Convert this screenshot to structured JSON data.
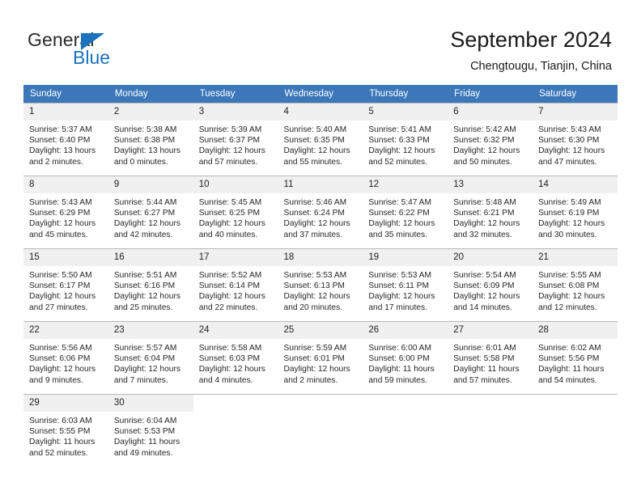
{
  "logo": {
    "word_top": "General",
    "word_bottom": "Blue",
    "triangle_color": "#1b72bd",
    "text_color": "#2b2b2b"
  },
  "header": {
    "title": "September 2024",
    "subtitle": "Chengtougu, Tianjin, China"
  },
  "theme": {
    "header_row_bg": "#3b77b9",
    "daynum_bg": "#f0f0f0",
    "grid_line": "#b9b9b9",
    "page_bg": "#ffffff"
  },
  "weekday_headers": [
    "Sunday",
    "Monday",
    "Tuesday",
    "Wednesday",
    "Thursday",
    "Friday",
    "Saturday"
  ],
  "weeks": [
    [
      {
        "day": "1",
        "sunrise": "Sunrise: 5:37 AM",
        "sunset": "Sunset: 6:40 PM",
        "daylight_line1": "Daylight: 13 hours",
        "daylight_line2": "and 2 minutes."
      },
      {
        "day": "2",
        "sunrise": "Sunrise: 5:38 AM",
        "sunset": "Sunset: 6:38 PM",
        "daylight_line1": "Daylight: 13 hours",
        "daylight_line2": "and 0 minutes."
      },
      {
        "day": "3",
        "sunrise": "Sunrise: 5:39 AM",
        "sunset": "Sunset: 6:37 PM",
        "daylight_line1": "Daylight: 12 hours",
        "daylight_line2": "and 57 minutes."
      },
      {
        "day": "4",
        "sunrise": "Sunrise: 5:40 AM",
        "sunset": "Sunset: 6:35 PM",
        "daylight_line1": "Daylight: 12 hours",
        "daylight_line2": "and 55 minutes."
      },
      {
        "day": "5",
        "sunrise": "Sunrise: 5:41 AM",
        "sunset": "Sunset: 6:33 PM",
        "daylight_line1": "Daylight: 12 hours",
        "daylight_line2": "and 52 minutes."
      },
      {
        "day": "6",
        "sunrise": "Sunrise: 5:42 AM",
        "sunset": "Sunset: 6:32 PM",
        "daylight_line1": "Daylight: 12 hours",
        "daylight_line2": "and 50 minutes."
      },
      {
        "day": "7",
        "sunrise": "Sunrise: 5:43 AM",
        "sunset": "Sunset: 6:30 PM",
        "daylight_line1": "Daylight: 12 hours",
        "daylight_line2": "and 47 minutes."
      }
    ],
    [
      {
        "day": "8",
        "sunrise": "Sunrise: 5:43 AM",
        "sunset": "Sunset: 6:29 PM",
        "daylight_line1": "Daylight: 12 hours",
        "daylight_line2": "and 45 minutes."
      },
      {
        "day": "9",
        "sunrise": "Sunrise: 5:44 AM",
        "sunset": "Sunset: 6:27 PM",
        "daylight_line1": "Daylight: 12 hours",
        "daylight_line2": "and 42 minutes."
      },
      {
        "day": "10",
        "sunrise": "Sunrise: 5:45 AM",
        "sunset": "Sunset: 6:25 PM",
        "daylight_line1": "Daylight: 12 hours",
        "daylight_line2": "and 40 minutes."
      },
      {
        "day": "11",
        "sunrise": "Sunrise: 5:46 AM",
        "sunset": "Sunset: 6:24 PM",
        "daylight_line1": "Daylight: 12 hours",
        "daylight_line2": "and 37 minutes."
      },
      {
        "day": "12",
        "sunrise": "Sunrise: 5:47 AM",
        "sunset": "Sunset: 6:22 PM",
        "daylight_line1": "Daylight: 12 hours",
        "daylight_line2": "and 35 minutes."
      },
      {
        "day": "13",
        "sunrise": "Sunrise: 5:48 AM",
        "sunset": "Sunset: 6:21 PM",
        "daylight_line1": "Daylight: 12 hours",
        "daylight_line2": "and 32 minutes."
      },
      {
        "day": "14",
        "sunrise": "Sunrise: 5:49 AM",
        "sunset": "Sunset: 6:19 PM",
        "daylight_line1": "Daylight: 12 hours",
        "daylight_line2": "and 30 minutes."
      }
    ],
    [
      {
        "day": "15",
        "sunrise": "Sunrise: 5:50 AM",
        "sunset": "Sunset: 6:17 PM",
        "daylight_line1": "Daylight: 12 hours",
        "daylight_line2": "and 27 minutes."
      },
      {
        "day": "16",
        "sunrise": "Sunrise: 5:51 AM",
        "sunset": "Sunset: 6:16 PM",
        "daylight_line1": "Daylight: 12 hours",
        "daylight_line2": "and 25 minutes."
      },
      {
        "day": "17",
        "sunrise": "Sunrise: 5:52 AM",
        "sunset": "Sunset: 6:14 PM",
        "daylight_line1": "Daylight: 12 hours",
        "daylight_line2": "and 22 minutes."
      },
      {
        "day": "18",
        "sunrise": "Sunrise: 5:53 AM",
        "sunset": "Sunset: 6:13 PM",
        "daylight_line1": "Daylight: 12 hours",
        "daylight_line2": "and 20 minutes."
      },
      {
        "day": "19",
        "sunrise": "Sunrise: 5:53 AM",
        "sunset": "Sunset: 6:11 PM",
        "daylight_line1": "Daylight: 12 hours",
        "daylight_line2": "and 17 minutes."
      },
      {
        "day": "20",
        "sunrise": "Sunrise: 5:54 AM",
        "sunset": "Sunset: 6:09 PM",
        "daylight_line1": "Daylight: 12 hours",
        "daylight_line2": "and 14 minutes."
      },
      {
        "day": "21",
        "sunrise": "Sunrise: 5:55 AM",
        "sunset": "Sunset: 6:08 PM",
        "daylight_line1": "Daylight: 12 hours",
        "daylight_line2": "and 12 minutes."
      }
    ],
    [
      {
        "day": "22",
        "sunrise": "Sunrise: 5:56 AM",
        "sunset": "Sunset: 6:06 PM",
        "daylight_line1": "Daylight: 12 hours",
        "daylight_line2": "and 9 minutes."
      },
      {
        "day": "23",
        "sunrise": "Sunrise: 5:57 AM",
        "sunset": "Sunset: 6:04 PM",
        "daylight_line1": "Daylight: 12 hours",
        "daylight_line2": "and 7 minutes."
      },
      {
        "day": "24",
        "sunrise": "Sunrise: 5:58 AM",
        "sunset": "Sunset: 6:03 PM",
        "daylight_line1": "Daylight: 12 hours",
        "daylight_line2": "and 4 minutes."
      },
      {
        "day": "25",
        "sunrise": "Sunrise: 5:59 AM",
        "sunset": "Sunset: 6:01 PM",
        "daylight_line1": "Daylight: 12 hours",
        "daylight_line2": "and 2 minutes."
      },
      {
        "day": "26",
        "sunrise": "Sunrise: 6:00 AM",
        "sunset": "Sunset: 6:00 PM",
        "daylight_line1": "Daylight: 11 hours",
        "daylight_line2": "and 59 minutes."
      },
      {
        "day": "27",
        "sunrise": "Sunrise: 6:01 AM",
        "sunset": "Sunset: 5:58 PM",
        "daylight_line1": "Daylight: 11 hours",
        "daylight_line2": "and 57 minutes."
      },
      {
        "day": "28",
        "sunrise": "Sunrise: 6:02 AM",
        "sunset": "Sunset: 5:56 PM",
        "daylight_line1": "Daylight: 11 hours",
        "daylight_line2": "and 54 minutes."
      }
    ],
    [
      {
        "day": "29",
        "sunrise": "Sunrise: 6:03 AM",
        "sunset": "Sunset: 5:55 PM",
        "daylight_line1": "Daylight: 11 hours",
        "daylight_line2": "and 52 minutes."
      },
      {
        "day": "30",
        "sunrise": "Sunrise: 6:04 AM",
        "sunset": "Sunset: 5:53 PM",
        "daylight_line1": "Daylight: 11 hours",
        "daylight_line2": "and 49 minutes."
      },
      null,
      null,
      null,
      null,
      null
    ]
  ]
}
